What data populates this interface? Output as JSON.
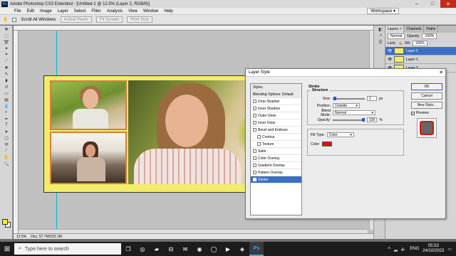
{
  "app": {
    "title": "Adobe Photoshop CS3 Extended - [Untitled-1 @ 12.5% (Layer 2, RGB/8)]",
    "logo": "Ps",
    "win_buttons": [
      "–",
      "□",
      "✕"
    ]
  },
  "menu": [
    "File",
    "Edit",
    "Image",
    "Layer",
    "Select",
    "Filter",
    "Analysis",
    "View",
    "Window",
    "Help"
  ],
  "workspace_label": "Workspace",
  "options": {
    "scroll_all": "Scroll All Windows",
    "actual_pixels": "Actual Pixels",
    "fit_screen": "Fit Screen",
    "print_size": "Print Size"
  },
  "doc": {
    "status": "Doc: 57.7M/232.1M",
    "zoom": "12.5%"
  },
  "layers_panel": {
    "tabs": [
      "Layers ×",
      "Channels",
      "Paths"
    ],
    "blend_mode": "Normal",
    "opacity_label": "Opacity:",
    "opacity_value": "100%",
    "lock_label": "Lock:",
    "fill_label": "Fill:",
    "fill_value": "100%",
    "layers": [
      {
        "name": "Layer 2",
        "active": true
      },
      {
        "name": "Layer 1",
        "active": false
      },
      {
        "name": "Layer 3",
        "active": false
      }
    ]
  },
  "dialog": {
    "title": "Layer Style",
    "styles_header": "Styles",
    "blending_options": "Blending Options: Default",
    "styles": [
      {
        "label": "Drop Shadow",
        "sub": false,
        "active": false
      },
      {
        "label": "Inner Shadow",
        "sub": false,
        "active": false
      },
      {
        "label": "Outer Glow",
        "sub": false,
        "active": false
      },
      {
        "label": "Inner Glow",
        "sub": false,
        "active": false
      },
      {
        "label": "Bevel and Emboss",
        "sub": false,
        "active": false
      },
      {
        "label": "Contour",
        "sub": true,
        "active": false
      },
      {
        "label": "Texture",
        "sub": true,
        "active": false
      },
      {
        "label": "Satin",
        "sub": false,
        "active": false
      },
      {
        "label": "Color Overlay",
        "sub": false,
        "active": false
      },
      {
        "label": "Gradient Overlay",
        "sub": false,
        "active": false
      },
      {
        "label": "Pattern Overlay",
        "sub": false,
        "active": false
      },
      {
        "label": "Stroke",
        "sub": false,
        "active": true
      }
    ],
    "stroke": {
      "heading": "Stroke",
      "structure": "Structure",
      "size_label": "Size:",
      "size_value": "1",
      "size_unit": "px",
      "size_level": 0.02,
      "position_label": "Position:",
      "position_value": "Outside",
      "blend_label": "Blend Mode:",
      "blend_value": "Normal",
      "opacity_label": "Opacity:",
      "opacity_value": "100",
      "opacity_unit": "%",
      "fill_type_label": "Fill Type:",
      "fill_type_value": "Color",
      "color_label": "Color:",
      "color_hex": "#e01010"
    },
    "buttons": {
      "ok": "OK",
      "cancel": "Cancel",
      "new_style": "New Style...",
      "preview": "Preview"
    }
  },
  "taskbar": {
    "search_placeholder": "Type here to search",
    "time": "05:53",
    "date": "24/10/2023",
    "lang": "ENG"
  },
  "colors": {
    "foreground": "#f5f500",
    "background": "#ffffff",
    "accent": "#3a6fc5"
  }
}
